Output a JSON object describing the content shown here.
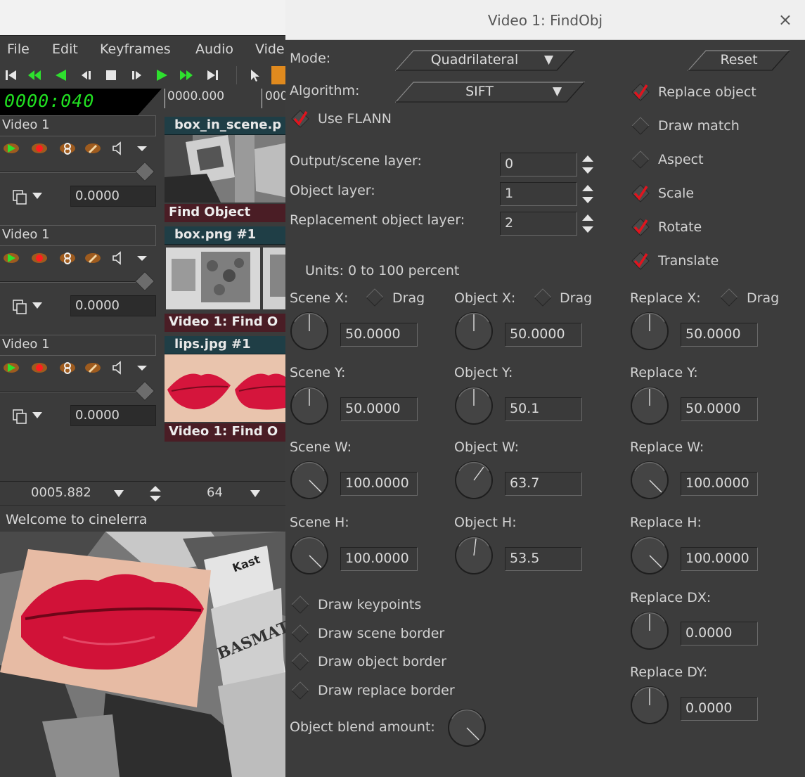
{
  "main": {
    "menus": [
      "File",
      "Edit",
      "Keyframes",
      "Audio",
      "Vide"
    ],
    "clock": "0000:040",
    "ruler": [
      "0000.000",
      "000"
    ],
    "tracks": [
      {
        "title": "Video 1",
        "fader": "0.0000",
        "edit_title": "box_in_scene.p",
        "plugin": "Find Object"
      },
      {
        "title": "Video 1",
        "fader": "0.0000",
        "edit_title": "box.png #1",
        "plugin": "Video 1: Find O"
      },
      {
        "title": "Video 1",
        "fader": "0.0000",
        "edit_title": "lips.jpg #1",
        "plugin": "Video 1: Find O"
      }
    ],
    "status_left": "0005.882",
    "status_zoom": "64",
    "welcome": "Welcome to cinelerra",
    "preview_text": "BASMATI",
    "preview_text2": "Kast"
  },
  "dialog": {
    "title": "Video 1: FindObj",
    "close": "×",
    "mode_label": "Mode:",
    "mode_value": "Quadrilateral",
    "reset": "Reset",
    "algorithm_label": "Algorithm:",
    "algorithm_value": "SIFT",
    "use_flann": "Use FLANN",
    "output_scene_layer_label": "Output/scene layer:",
    "output_scene_layer": "0",
    "object_layer_label": "Object layer:",
    "object_layer": "1",
    "replacement_layer_label": "Replacement object layer:",
    "replacement_layer": "2",
    "right_checks": [
      {
        "label": "Replace object",
        "checked": true
      },
      {
        "label": "Draw match",
        "checked": false
      },
      {
        "label": "Aspect",
        "checked": false
      },
      {
        "label": "Scale",
        "checked": true
      },
      {
        "label": "Rotate",
        "checked": true
      },
      {
        "label": "Translate",
        "checked": true
      }
    ],
    "units": "Units: 0 to 100 percent",
    "drag": "Drag",
    "scene_x_label": "Scene X:",
    "scene_x": "50.0000",
    "scene_y_label": "Scene Y:",
    "scene_y": "50.0000",
    "scene_w_label": "Scene W:",
    "scene_w": "100.0000",
    "scene_h_label": "Scene H:",
    "scene_h": "100.0000",
    "object_x_label": "Object X:",
    "object_x": "50.0000",
    "object_y_label": "Object Y:",
    "object_y": "50.1",
    "object_w_label": "Object W:",
    "object_w": "63.7",
    "object_h_label": "Object H:",
    "object_h": "53.5",
    "replace_x_label": "Replace X:",
    "replace_x": "50.0000",
    "replace_y_label": "Replace Y:",
    "replace_y": "50.0000",
    "replace_w_label": "Replace W:",
    "replace_w": "100.0000",
    "replace_h_label": "Replace H:",
    "replace_h": "100.0000",
    "replace_dx_label": "Replace DX:",
    "replace_dx": "0.0000",
    "replace_dy_label": "Replace DY:",
    "replace_dy": "0.0000",
    "draw_keypoints": "Draw keypoints",
    "draw_scene_border": "Draw scene border",
    "draw_object_border": "Draw object border",
    "draw_replace_border": "Draw replace border",
    "blend_label": "Object blend amount:",
    "colors": {
      "bg": "#3c3c3c",
      "check": "#e0141e",
      "clock": "#21e021",
      "edit_title": "#1f3e46",
      "plugin": "#4a1d25"
    }
  }
}
